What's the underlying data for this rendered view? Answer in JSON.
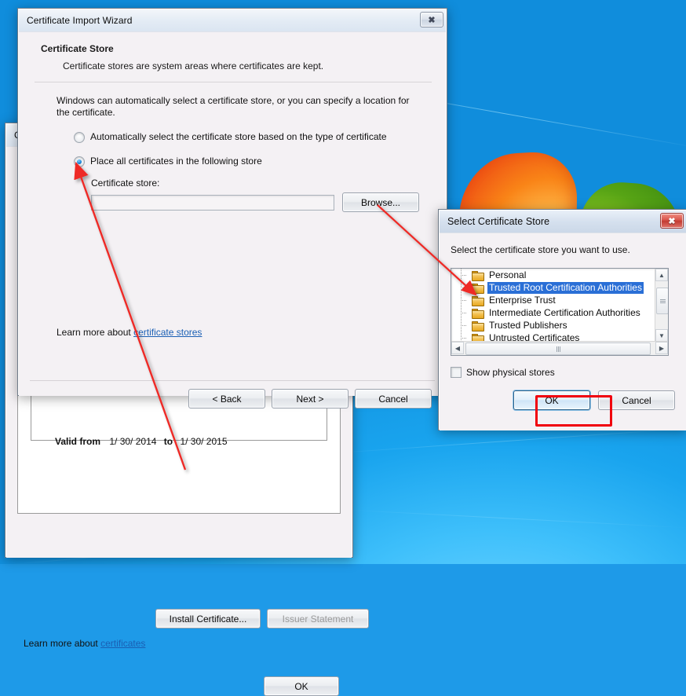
{
  "desktop": {
    "name": "windows-desktop-wallpaper"
  },
  "wizard": {
    "title": "Certificate Import Wizard",
    "close_label": "✖",
    "heading": "Certificate Store",
    "subheading": "Certificate stores are system areas where certificates are kept.",
    "paragraph": "Windows can automatically select a certificate store, or you can specify a location for the certificate.",
    "radio_auto_label": "Automatically select the certificate store based on the type of certificate",
    "radio_auto_checked": false,
    "radio_place_label": "Place all certificates in the following store",
    "radio_place_checked": true,
    "store_field_label": "Certificate store:",
    "store_field_value": "",
    "browse_label": "Browse...",
    "learn_prefix": "Learn more about ",
    "learn_link": "certificate stores",
    "back_label": "< Back",
    "next_label": "Next >",
    "cancel_label": "Cancel"
  },
  "certificate_window": {
    "title": "C",
    "valid_from_label": "Valid from",
    "valid_from_date": "1/ 30/ 2014",
    "valid_to_label": "to",
    "valid_to_date": "1/ 30/ 2015",
    "install_label": "Install Certificate...",
    "issuer_label": "Issuer Statement",
    "learn_prefix": "Learn more about ",
    "learn_link": "certificates",
    "ok_label": "OK"
  },
  "select_store": {
    "title": "Select Certificate Store",
    "close_label": "✖",
    "prompt": "Select the certificate store you want to use.",
    "items": [
      {
        "label": "Personal",
        "selected": false
      },
      {
        "label": "Trusted Root Certification Authorities",
        "selected": true
      },
      {
        "label": "Enterprise Trust",
        "selected": false
      },
      {
        "label": "Intermediate Certification Authorities",
        "selected": false
      },
      {
        "label": "Trusted Publishers",
        "selected": false
      },
      {
        "label": "Untrusted Certificates",
        "selected": false
      }
    ],
    "show_physical_label": "Show physical stores",
    "show_physical_checked": false,
    "ok_label": "OK",
    "cancel_label": "Cancel",
    "scroll_up_glyph": "▲",
    "scroll_down_glyph": "▼",
    "scroll_left_glyph": "◀",
    "scroll_right_glyph": "▶"
  },
  "annotations": {
    "highlight_color": "#f0000d",
    "arrow_color": "#ee2b28",
    "arrows": [
      {
        "name": "arrow-install-to-radio",
        "from": "Install Certificate... button",
        "to": "Place all certificates in the following store radio"
      },
      {
        "name": "arrow-browse-to-store-item",
        "from": "Browse... button",
        "to": "Trusted Root Certification Authorities list item"
      }
    ],
    "highlight_target": "OK button of Select Certificate Store"
  }
}
